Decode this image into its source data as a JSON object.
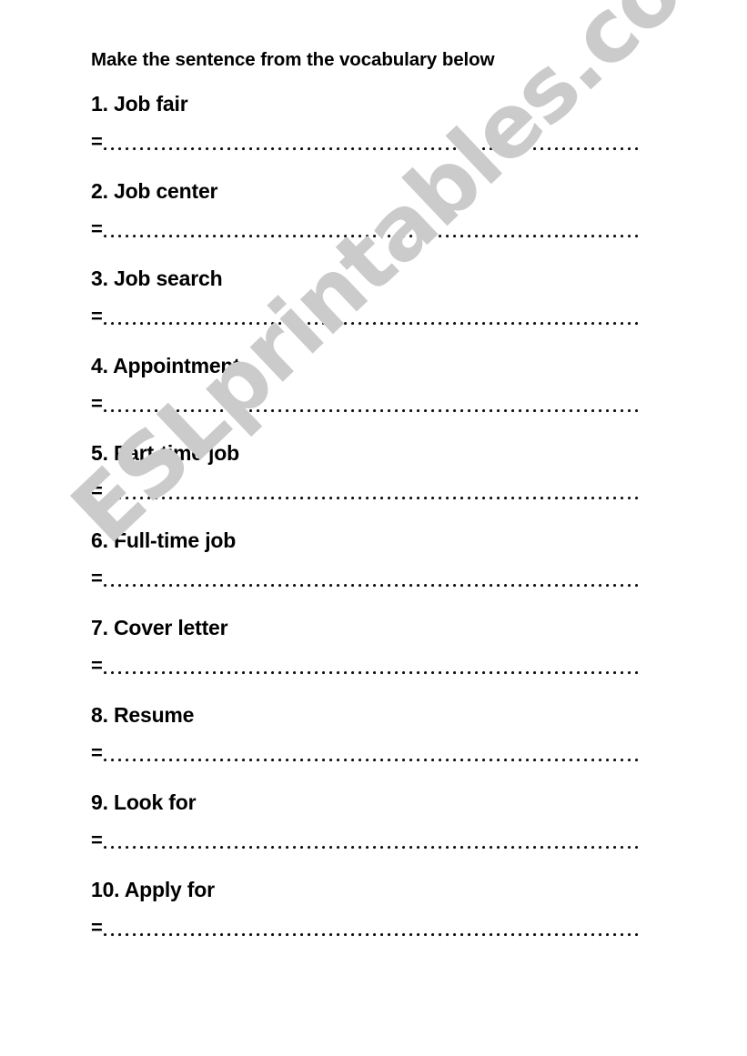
{
  "worksheet": {
    "title": "Make the sentence from the vocabulary below",
    "answer_prefix": "=",
    "items": [
      {
        "number": "1.",
        "term": "Job fair",
        "label": "1. Job fair"
      },
      {
        "number": "2.",
        "term": "Job center",
        "label": "2. Job center"
      },
      {
        "number": "3.",
        "term": "Job search",
        "label": "3. Job search"
      },
      {
        "number": "4.",
        "term": "Appointment",
        "label": "4. Appointment"
      },
      {
        "number": "5.",
        "term": "Part-time job",
        "label": "5. Part-time job"
      },
      {
        "number": "6.",
        "term": "Full-time job",
        "label": "6. Full-time job"
      },
      {
        "number": "7.",
        "term": "Cover letter",
        "label": "7. Cover letter"
      },
      {
        "number": "8.",
        "term": "Resume",
        "label": "8. Resume"
      },
      {
        "number": "9.",
        "term": "Look for",
        "label": "9. Look for"
      },
      {
        "number": "10.",
        "term": "Apply for",
        "label": "10. Apply for"
      }
    ]
  },
  "watermark": {
    "text": "ESLprintables.com",
    "color": "#cbcbcb"
  },
  "page": {
    "background_color": "#ffffff",
    "text_color": "#000000"
  }
}
